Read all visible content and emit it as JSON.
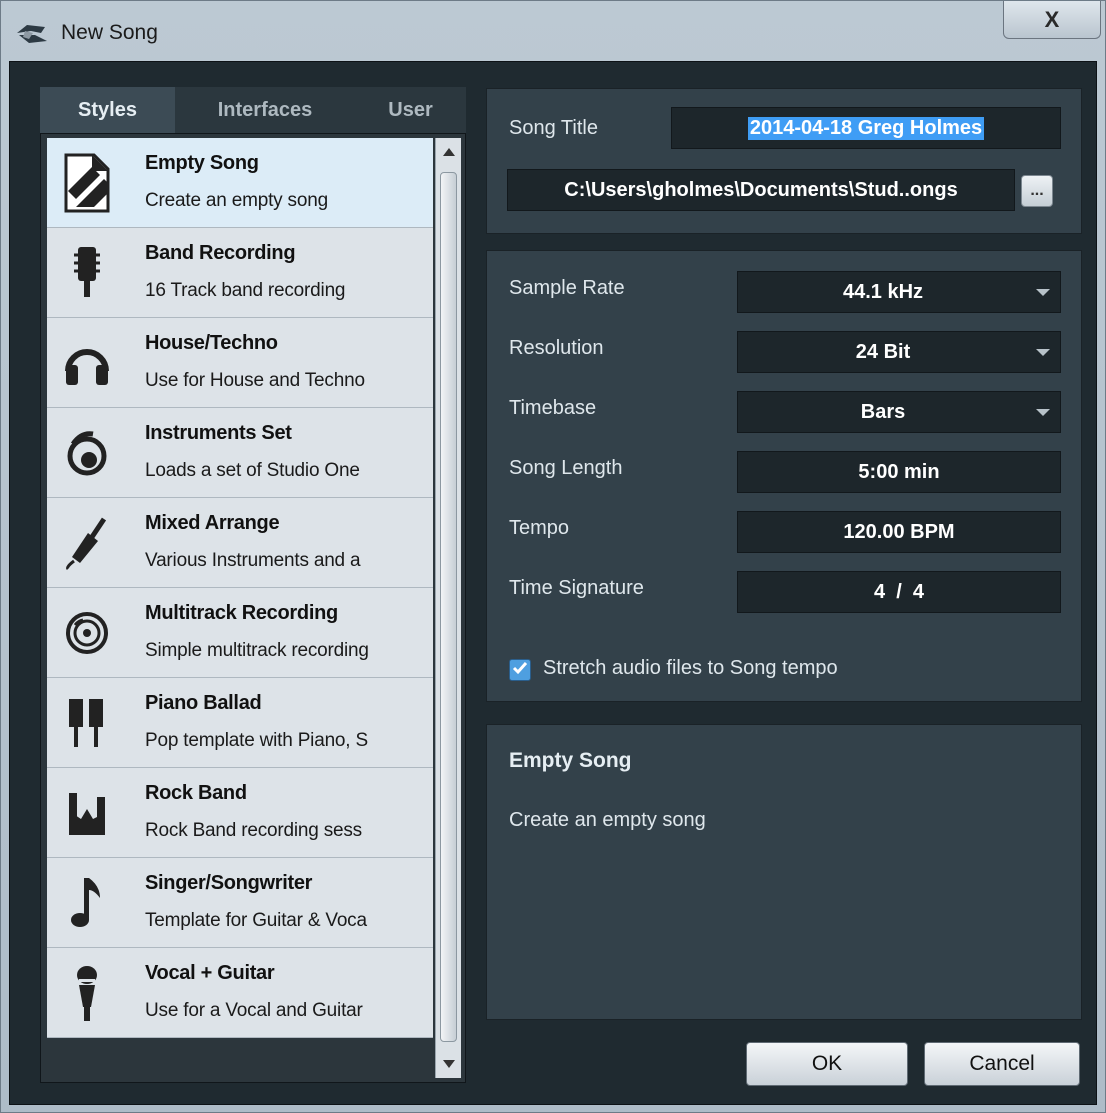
{
  "window": {
    "title": "New Song",
    "close_label": "X"
  },
  "tabs": [
    {
      "label": "Styles",
      "active": true
    },
    {
      "label": "Interfaces",
      "active": false
    },
    {
      "label": "User",
      "active": false
    }
  ],
  "templates": [
    {
      "name": "Empty Song",
      "description": "Create an empty song",
      "icon": "empty-song-icon",
      "selected": true
    },
    {
      "name": "Band Recording",
      "description": "16 Track band recording",
      "icon": "microphone-icon"
    },
    {
      "name": "House/Techno",
      "description": "Use for House and Techno",
      "icon": "headphones-icon"
    },
    {
      "name": "Instruments Set",
      "description": "Loads a set of  Studio One",
      "icon": "instruments-icon"
    },
    {
      "name": "Mixed Arrange",
      "description": "Various Instruments and a",
      "icon": "cable-icon"
    },
    {
      "name": "Multitrack Recording",
      "description": "Simple multitrack recording",
      "icon": "disc-icon"
    },
    {
      "name": "Piano Ballad",
      "description": "Pop template with Piano, S",
      "icon": "piano-keys-icon"
    },
    {
      "name": "Rock Band",
      "description": "Rock Band recording sess",
      "icon": "rock-hand-icon"
    },
    {
      "name": "Singer/Songwriter",
      "description": "Template for Guitar & Voca",
      "icon": "music-note-icon"
    },
    {
      "name": "Vocal + Guitar",
      "description": "Use for a Vocal and Guitar",
      "icon": "vocal-mic-icon"
    }
  ],
  "song": {
    "title_label": "Song Title",
    "title_value": "2014-04-18 Greg Holmes",
    "path_value": "C:\\Users\\gholmes\\Documents\\Stud..ongs",
    "browse_label": "..."
  },
  "settings": {
    "sample_rate_label": "Sample Rate",
    "sample_rate_value": "44.1 kHz",
    "resolution_label": "Resolution",
    "resolution_value": "24 Bit",
    "timebase_label": "Timebase",
    "timebase_value": "Bars",
    "song_length_label": "Song Length",
    "song_length_value": "5:00 min",
    "tempo_label": "Tempo",
    "tempo_value": "120.00 BPM",
    "time_signature_label": "Time Signature",
    "time_signature_value": "4  /  4",
    "stretch_label": "Stretch audio files to Song tempo",
    "stretch_checked": true
  },
  "info": {
    "title": "Empty Song",
    "description": "Create an empty song"
  },
  "buttons": {
    "ok": "OK",
    "cancel": "Cancel"
  },
  "colors": {
    "accent": "#3f9df5",
    "panel": "#33414a",
    "background": "#1f2a30"
  }
}
